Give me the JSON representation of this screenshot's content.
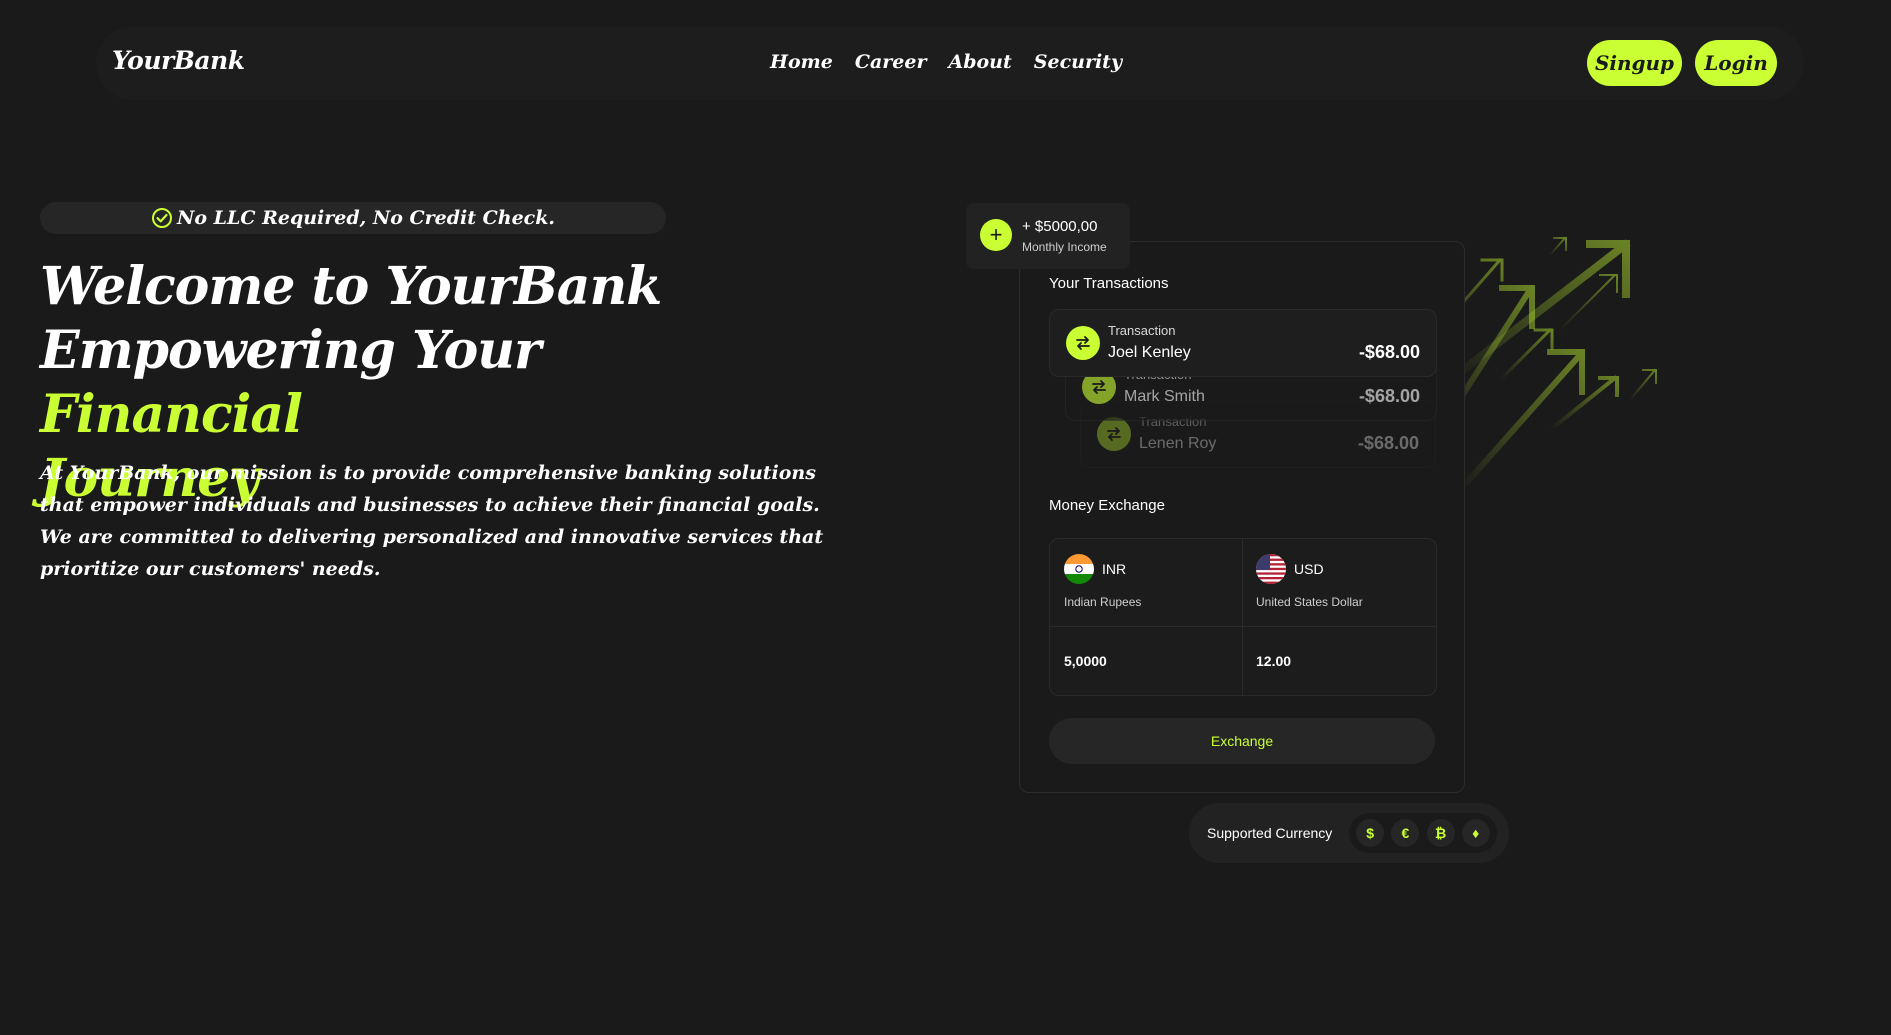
{
  "nav": {
    "brand": "YourBank",
    "links": [
      "Home",
      "Career",
      "About",
      "Security"
    ],
    "signup_label": "Singup",
    "login_label": "Login"
  },
  "hero": {
    "badge": "No LLC Required, No Credit Check.",
    "headline_line1": "Welcome to YourBank",
    "headline_line2_prefix": "Empowering Your ",
    "headline_accent_1": "Financial",
    "headline_accent_2": "Journey",
    "description": "At YourBank, our mission is to provide comprehensive banking solutions that empower individuals and businesses to achieve their financial goals. We are committed to delivering personalized and innovative services that prioritize our customers' needs."
  },
  "income": {
    "amount": "+ $5000,00",
    "label": "Monthly Income"
  },
  "transactions": {
    "title": "Your Transactions",
    "items": [
      {
        "type": "Transaction",
        "name": "Joel Kenley",
        "amount": "-$68.00"
      },
      {
        "type": "Transaction",
        "name": "Mark Smith",
        "amount": "-$68.00"
      },
      {
        "type": "Transaction",
        "name": "Lenen Roy",
        "amount": "-$68.00"
      }
    ]
  },
  "exchange": {
    "title": "Money Exchange",
    "from": {
      "code": "INR",
      "name": "Indian Rupees",
      "value": "5,0000"
    },
    "to": {
      "code": "USD",
      "name": "United States Dollar",
      "value": "12.00"
    },
    "button_label": "Exchange"
  },
  "supported": {
    "label": "Supported Currency",
    "icons": [
      "$",
      "€",
      "₿",
      "♦"
    ]
  },
  "colors": {
    "accent": "#caff33",
    "background": "#1a1a1a"
  }
}
